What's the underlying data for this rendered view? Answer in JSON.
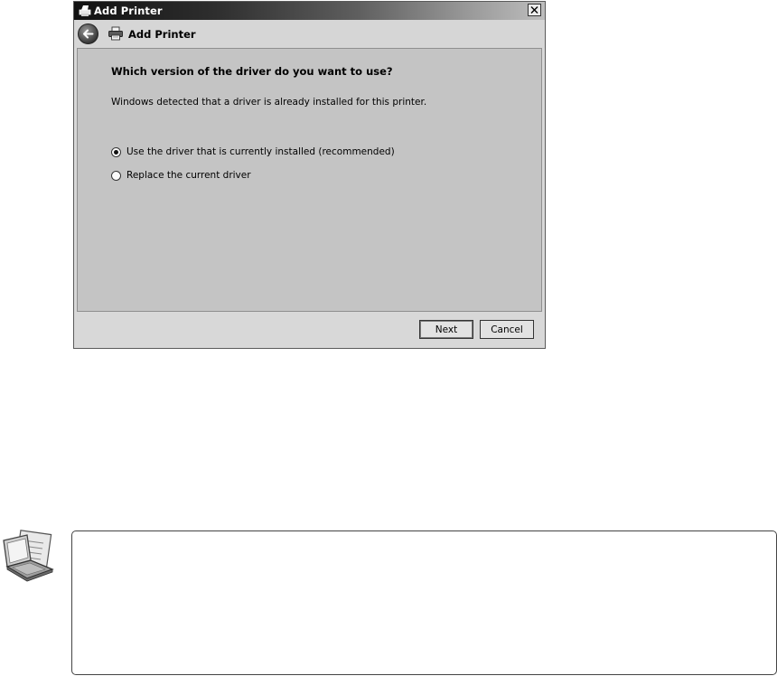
{
  "window": {
    "title": "Add Printer",
    "close_glyph": "✕"
  },
  "nav": {
    "title": "Add Printer",
    "back_icon": "back-arrow-icon",
    "printer_icon": "printer-icon"
  },
  "content": {
    "heading": "Which version of the driver do you want to use?",
    "description": "Windows detected that a driver is already installed for this printer.",
    "options": [
      {
        "label": "Use the driver that is currently installed (recommended)",
        "selected": true
      },
      {
        "label": "Replace the current driver",
        "selected": false
      }
    ]
  },
  "buttons": {
    "next": "Next",
    "cancel": "Cancel"
  },
  "note": {
    "icon": "note-laptop-icon"
  },
  "colors": {
    "titlebar_dark": "#111111",
    "dialog_bg": "#d8d8d8",
    "content_bg": "#c4c4c4"
  }
}
